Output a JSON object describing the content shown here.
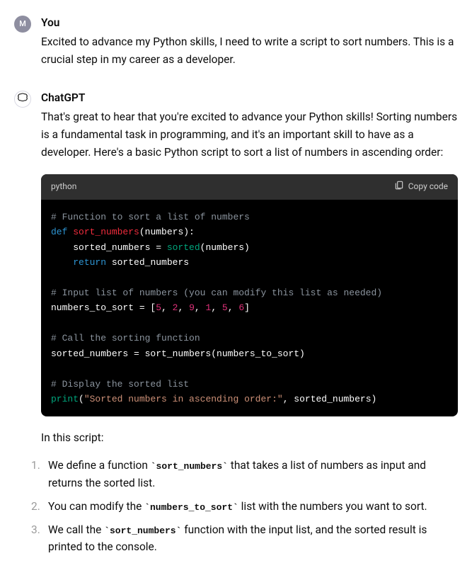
{
  "user": {
    "sender": "You",
    "avatar_letter": "M",
    "text": "Excited to advance my Python skills, I need to write a script to sort numbers. This is a crucial step in my career as a developer."
  },
  "assistant": {
    "sender": "ChatGPT",
    "intro": "That's great to hear that you're excited to advance your Python skills! Sorting numbers is a fundamental task in programming, and it's an important skill to have as a developer. Here's a basic Python script to sort a list of numbers in ascending order:",
    "code": {
      "language": "python",
      "copy_label": "Copy code",
      "lines": {
        "c1": "# Function to sort a list of numbers",
        "kw_def": "def",
        "fn_name": "sort_numbers",
        "l2_rest": "(numbers):",
        "l3_a": "    sorted_numbers = ",
        "sorted": "sorted",
        "l3_c": "(numbers)",
        "kw_return": "return",
        "l4_b": " sorted_numbers",
        "c2": "# Input list of numbers (you can modify this list as needed)",
        "l6_a": "numbers_to_sort = [",
        "n1": "5",
        "n2": "2",
        "n3": "9",
        "n4": "1",
        "n5": "5",
        "n6": "6",
        "l6_end": "]",
        "c3": "# Call the sorting function",
        "l8": "sorted_numbers = sort_numbers(numbers_to_sort)",
        "c4": "# Display the sorted list",
        "print": "print",
        "l10_b": "(",
        "str1": "\"Sorted numbers in ascending order:\"",
        "l10_d": ", sorted_numbers)"
      }
    },
    "after_code": "In this script:",
    "items": {
      "i1a": "We define a function ",
      "i1code": "`sort_numbers`",
      "i1b": " that takes a list of numbers as input and returns the sorted list.",
      "i2a": "You can modify the ",
      "i2code": "`numbers_to_sort`",
      "i2b": " list with the numbers you want to sort.",
      "i3a": "We call the ",
      "i3code": "`sort_numbers`",
      "i3b": " function with the input list, and the sorted result is printed to the console."
    }
  }
}
